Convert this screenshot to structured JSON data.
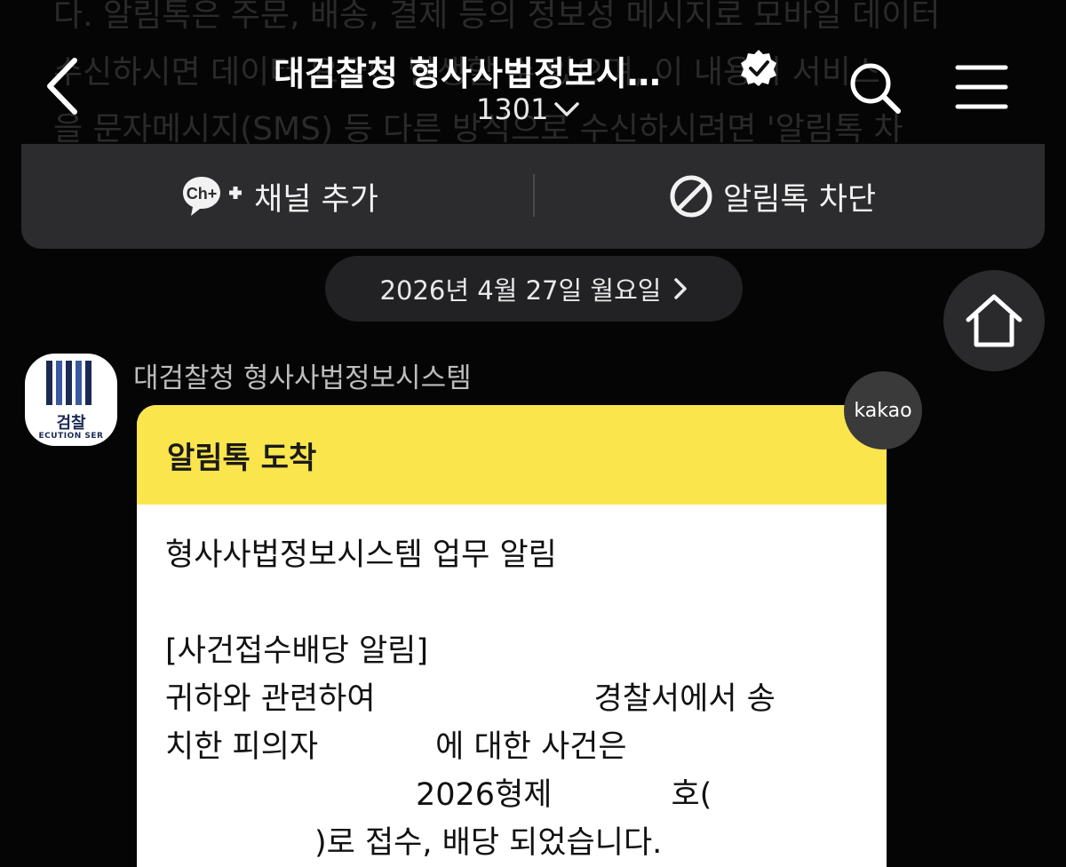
{
  "background_text": [
    "다. 알림톡은 주문, 배송, 결제 등의 정보성 메시지로 모바일 데이터",
    "수신하시면 데이터 요금이 발생할 수 있으며, 이 내용의 서비스",
    "을 문자메시지(SMS) 등 다른 방식으로 수신하시려면 '알림톡 차"
  ],
  "header": {
    "title": "대검찰청 형사사법정보시…",
    "subtitle": "1301"
  },
  "actions": {
    "add_channel_icon": "Ch+",
    "add_channel": "채널 추가",
    "block": "알림톡 차단"
  },
  "date_label": "2026년 4월 27일 월요일",
  "sender": {
    "avatar_text": "검찰",
    "avatar_sub": "ECUTION SER",
    "name": "대검찰청 형사사법정보시스템"
  },
  "message": {
    "header": "알림톡 도착",
    "badge": "kakao",
    "line1": "형사사법정보시스템 업무 알림",
    "line2": "[사건접수배당 알림]",
    "line3a": "귀하와 관련하여",
    "line3b": "경찰서에서 송",
    "line4a": "치한 피의자",
    "line4b": "에 대한 사건은",
    "line5a": "2026형제",
    "line5b": "호(",
    "line6": ")로 접수, 배당 되었습니다."
  },
  "colors": {
    "background": "#050505",
    "bar": "#2c2c2e",
    "kakao_yellow": "#fae54d"
  }
}
